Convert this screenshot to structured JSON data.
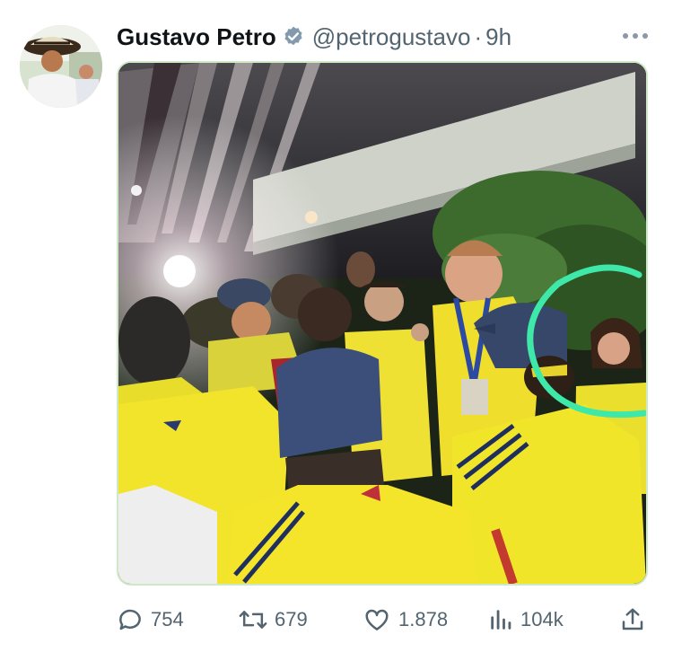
{
  "author": {
    "name": "Gustavo Petro",
    "handle": "@petrogustavo",
    "separator": "·",
    "time": "9h",
    "verified_icon": "verified-badge-icon",
    "avatar_icon": "avatar-photo"
  },
  "menu": {
    "icon": "more-dots-icon"
  },
  "media": {
    "description_icon": "attached-photo",
    "highlight_color": "#3ee8a8"
  },
  "actions": {
    "replies": "754",
    "retweets": "679",
    "likes": "1.878",
    "views": "104k"
  },
  "colors": {
    "jersey_yellow": "#f2e627",
    "text_secondary": "#536471",
    "verified_grey": "#829aab"
  }
}
